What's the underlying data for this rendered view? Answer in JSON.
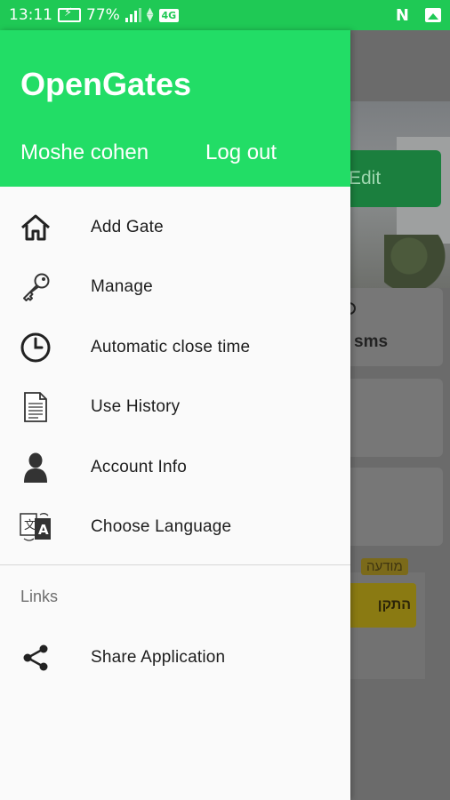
{
  "status_bar": {
    "time": "13:11",
    "battery_percent": "77%",
    "network": "4G",
    "icons": [
      "battery-charging-icon",
      "signal-icon",
      "data-arrows-icon",
      "n-notification-icon",
      "image-notification-icon"
    ]
  },
  "drawer": {
    "app_title": "OpenGates",
    "user_name": "Moshe cohen",
    "logout_label": "Log out",
    "accent_color": "#22dd66",
    "menu": [
      {
        "label": "Add Gate",
        "icon": "home-icon"
      },
      {
        "label": "Manage",
        "icon": "key-icon"
      },
      {
        "label": "Automatic close time",
        "icon": "clock-icon"
      },
      {
        "label": "Use History",
        "icon": "document-icon"
      },
      {
        "label": "Account Info",
        "icon": "person-icon"
      },
      {
        "label": "Choose Language",
        "icon": "translate-icon"
      }
    ],
    "links_section_title": "Links",
    "links": [
      {
        "label": "Share Application",
        "icon": "share-icon"
      }
    ]
  },
  "background_app": {
    "edit_label": "Edit",
    "sms_label": "sms",
    "info_tag": "מודעה",
    "yellow_button_label": "התקן"
  }
}
